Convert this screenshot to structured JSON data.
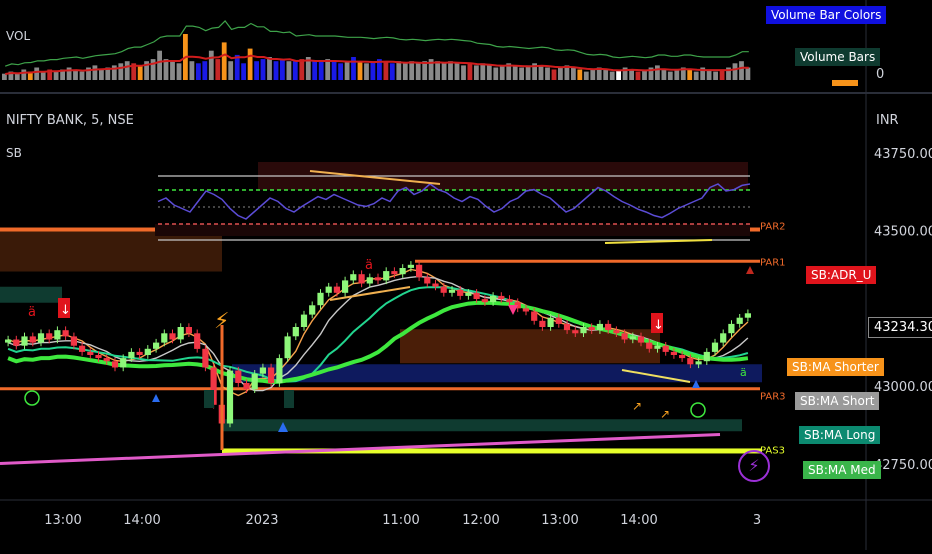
{
  "header": {
    "vol_label": "VOL",
    "symbol_label": "NIFTY BANK, 5, NSE",
    "indicator_label": "SB",
    "currency_label": "INR",
    "vol_zero_label": "0"
  },
  "legend": {
    "volume_bar_colors": "Volume Bar Colors",
    "volume_bars": "Volume Bars"
  },
  "tags": {
    "adr_u": "SB:ADR_U",
    "current_price": "43234.30",
    "ma_shorter": "SB:MA Shorter",
    "ma_short": "SB:MA Short",
    "ma_long": "SB:MA Long",
    "ma_med": "SB:MA Med"
  },
  "level_labels": {
    "par2": "PAR2",
    "par1": "PAR1",
    "par3": "PAR3",
    "pas3": "PAS3"
  },
  "colors": {
    "background": "#000000",
    "up_candle": "#8ef77a",
    "down_candle": "#f23645",
    "resistance": "#f06a2a",
    "ma_short": "#c8c8c8",
    "ma_long": "#22d58f",
    "ma_med": "#3ee83e",
    "ma_shorter": "#f7a24b",
    "oscillator": "#5b4cd6",
    "pas3": "#e6ff2a"
  },
  "chart_data": [
    {
      "type": "bar",
      "name": "volume-pane",
      "ylabel": "",
      "note_levels": "0",
      "values": [
        3,
        4,
        3,
        5,
        4,
        6,
        4,
        5,
        4,
        5,
        6,
        5,
        4,
        6,
        7,
        5,
        6,
        7,
        8,
        9,
        8,
        7,
        9,
        10,
        14,
        10,
        9,
        8,
        22,
        9,
        8,
        9,
        14,
        10,
        18,
        9,
        12,
        8,
        15,
        9,
        10,
        11,
        9,
        10,
        9,
        9,
        10,
        11,
        9,
        9,
        10,
        9,
        8,
        9,
        11,
        9,
        8,
        9,
        10,
        9,
        8,
        9,
        8,
        9,
        8,
        9,
        10,
        9,
        8,
        9,
        8,
        7,
        8,
        7,
        8,
        7,
        6,
        7,
        8,
        7,
        6,
        7,
        8,
        7,
        6,
        5,
        6,
        7,
        6,
        5,
        4,
        5,
        6,
        5,
        4,
        5,
        6,
        5,
        4,
        5,
        6,
        7,
        5,
        4,
        5,
        6,
        5,
        4,
        6,
        5,
        4,
        5,
        6,
        8,
        9,
        6
      ],
      "volume_bar_colors": [
        "gray",
        "red",
        "orange",
        "blue"
      ]
    },
    {
      "type": "line",
      "name": "price-pane",
      "ylabel": "INR",
      "y_ticks": [
        43750.0,
        43500.0,
        43000.0,
        42750.0
      ],
      "ylim": [
        42650,
        43920
      ],
      "x_tick_labels": [
        "13:00",
        "14:00",
        "2023",
        "11:00",
        "12:00",
        "13:00",
        "14:00",
        "3"
      ],
      "last_price": 43234.3,
      "levels": {
        "PAR2": 43510,
        "PAR1": 43400,
        "PAR3": 42990,
        "PAS3": 42790
      },
      "candles_close": [
        43150,
        43130,
        43160,
        43140,
        43170,
        43150,
        43180,
        43160,
        43130,
        43110,
        43100,
        43090,
        43080,
        43060,
        43090,
        43110,
        43100,
        43120,
        43140,
        43170,
        43150,
        43190,
        43170,
        43120,
        43060,
        42940,
        42880,
        43050,
        43010,
        42990,
        43040,
        43060,
        43010,
        43090,
        43160,
        43190,
        43230,
        43260,
        43300,
        43320,
        43300,
        43340,
        43360,
        43330,
        43350,
        43340,
        43370,
        43360,
        43380,
        43390,
        43350,
        43330,
        43320,
        43300,
        43310,
        43290,
        43300,
        43280,
        43270,
        43290,
        43280,
        43270,
        43250,
        43240,
        43210,
        43190,
        43220,
        43200,
        43180,
        43170,
        43190,
        43180,
        43200,
        43180,
        43170,
        43150,
        43160,
        43140,
        43120,
        43130,
        43110,
        43100,
        43090,
        43070,
        43080,
        43110,
        43140,
        43170,
        43200,
        43220,
        43234.3
      ]
    },
    {
      "type": "line",
      "name": "oscillator-pane",
      "values": [
        55,
        60,
        50,
        45,
        40,
        55,
        70,
        65,
        58,
        45,
        35,
        30,
        40,
        50,
        60,
        55,
        45,
        40,
        48,
        55,
        62,
        58,
        65,
        60,
        55,
        50,
        48,
        52,
        60,
        55,
        70,
        75,
        65,
        70,
        80,
        72,
        68,
        60,
        55,
        62,
        58,
        48,
        40,
        45,
        55,
        60,
        70,
        72,
        65,
        60,
        50,
        40,
        45,
        55,
        65,
        75,
        70,
        62,
        55,
        50,
        44,
        40,
        35,
        32,
        38,
        45,
        50,
        55,
        60,
        75,
        80,
        70,
        72,
        78,
        80
      ]
    }
  ]
}
